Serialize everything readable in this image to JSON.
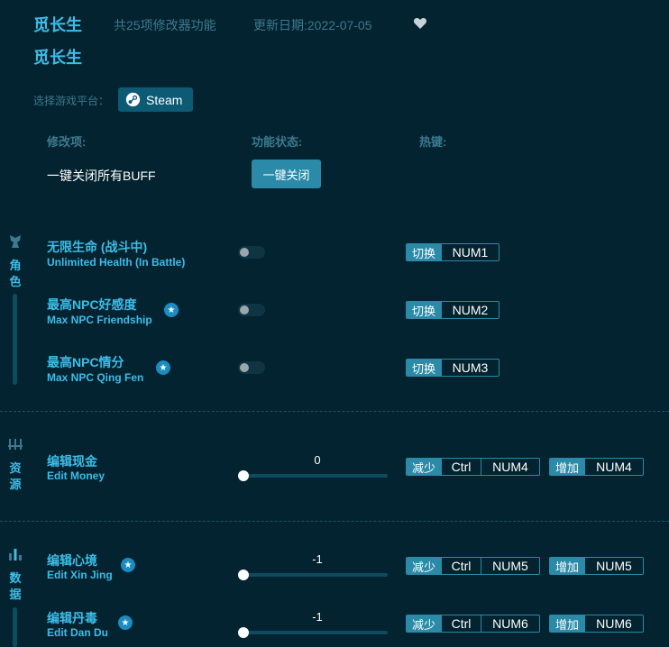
{
  "header": {
    "app_name": "觅长生",
    "subtitle_count": "共25项修改器功能",
    "update_date": "更新日期:2022-07-05",
    "game_title": "觅长生"
  },
  "platform": {
    "label": "选择游戏平台：",
    "selected": "Steam"
  },
  "columns": {
    "item": "修改项:",
    "status": "功能状态:",
    "hotkey": "热键:"
  },
  "close_all": {
    "label": "一键关闭所有BUFF",
    "button": "一键关闭"
  },
  "sections": {
    "character": {
      "label_1": "角",
      "label_2": "色"
    },
    "resources": {
      "label_1": "资",
      "label_2": "源"
    },
    "data": {
      "label_1": "数",
      "label_2": "据"
    }
  },
  "items": {
    "health": {
      "cn": "无限生命 (战斗中)",
      "en": "Unlimited Health (In Battle)",
      "toggle_tag": "切换",
      "key": "NUM1",
      "enabled": false
    },
    "friendship": {
      "cn": "最高NPC好感度",
      "en": "Max NPC Friendship",
      "toggle_tag": "切换",
      "key": "NUM2",
      "enabled": false
    },
    "qingfen": {
      "cn": "最高NPC情分",
      "en": "Max NPC Qing Fen",
      "toggle_tag": "切换",
      "key": "NUM3",
      "enabled": false
    },
    "money": {
      "cn": "编辑现金",
      "en": "Edit Money",
      "value": "0",
      "dec_tag": "减少",
      "dec_mod": "Ctrl",
      "dec_key": "NUM4",
      "inc_tag": "增加",
      "inc_key": "NUM4"
    },
    "xinjing": {
      "cn": "编辑心境",
      "en": "Edit Xin Jing",
      "value": "-1",
      "dec_tag": "减少",
      "dec_mod": "Ctrl",
      "dec_key": "NUM5",
      "inc_tag": "增加",
      "inc_key": "NUM5"
    },
    "dandu": {
      "cn": "编辑丹毒",
      "en": "Edit Dan Du",
      "value": "-1",
      "dec_tag": "减少",
      "dec_mod": "Ctrl",
      "dec_key": "NUM6",
      "inc_tag": "增加",
      "inc_key": "NUM6"
    }
  },
  "colors": {
    "background": "#02232f",
    "accent": "#3dbde8",
    "button": "#2a8aa8"
  }
}
